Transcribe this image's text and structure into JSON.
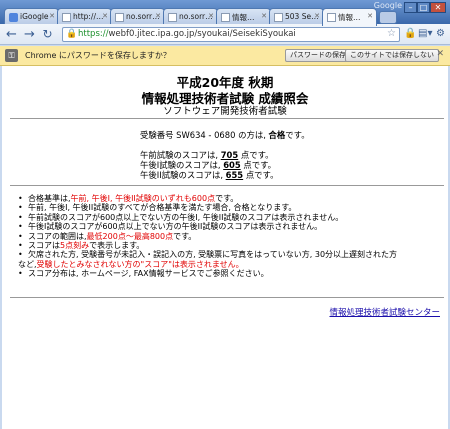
{
  "browser": {
    "google_mark": "Google",
    "tabs": [
      {
        "title": "iGoogle",
        "favicon": "google-icon"
      },
      {
        "title": "http://…",
        "favicon": "page-icon"
      },
      {
        "title": "no.sorr…",
        "favicon": "page-icon"
      },
      {
        "title": "no.sorr…",
        "favicon": "page-icon"
      },
      {
        "title": "情報…",
        "favicon": "page-icon"
      },
      {
        "title": "503 Se…",
        "favicon": "page-icon"
      },
      {
        "title": "情報…",
        "favicon": "page-icon",
        "active": true
      }
    ],
    "url_scheme": "https://",
    "url_rest": "webf0.jitec.ipa.go.jp/syoukai/SeisekiSyoukai"
  },
  "infobar": {
    "message": "Chrome にパスワードを保存しますか？",
    "save_label": "パスワードの保存",
    "never_label": "このサイトでは保存しない"
  },
  "page": {
    "title1": "平成20年度 秋期",
    "title2": "情報処理技術者試験 成績照会",
    "subtitle": "ソフトウェア開発技術者試験",
    "result_prefix": "受験番号 SW634 - 0680 の方は,",
    "result_status": "合格",
    "result_suffix": "です。",
    "scores": [
      {
        "prefix": "午前試験のスコアは,",
        "value": "705",
        "suffix": "点です。"
      },
      {
        "prefix": "午後I試験のスコアは,",
        "value": "605",
        "suffix": "点です。"
      },
      {
        "prefix": "午後II試験のスコアは,",
        "value": "655",
        "suffix": "点です。"
      }
    ],
    "notes": [
      {
        "parts": [
          {
            "t": "合格基準は,"
          },
          {
            "t": "午前, 午後I, 午後II試験のいずれも600点",
            "red": true
          },
          {
            "t": "です。"
          }
        ]
      },
      {
        "parts": [
          {
            "t": "午前, 午後I, 午後II試験のすべてが合格基準を満たす場合, 合格となります。"
          }
        ]
      },
      {
        "parts": [
          {
            "t": "午前試験のスコアが600点以上でない方の午後I, 午後II試験のスコアは表示されません。"
          }
        ]
      },
      {
        "parts": [
          {
            "t": "午後I試験のスコアが600点以上でない方の午後II試験のスコアは表示されません。"
          }
        ]
      },
      {
        "parts": [
          {
            "t": "スコアの範囲は,"
          },
          {
            "t": "最低200点～最高800点",
            "red": true
          },
          {
            "t": "です。"
          }
        ]
      },
      {
        "parts": [
          {
            "t": "スコアは"
          },
          {
            "t": "5点刻み",
            "red": true
          },
          {
            "t": "で表示します。"
          }
        ]
      },
      {
        "parts": [
          {
            "t": "欠席された方, 受験番号が未記入・誤記入の方, 受験票に写真をはっていない方, 30分以上遅刻された方"
          }
        ]
      },
      {
        "parts": [
          {
            "t": "など,"
          },
          {
            "t": "受験したとみなされない方の\"スコア\"は表示されません。",
            "red": true
          }
        ],
        "continuation": true
      },
      {
        "parts": [
          {
            "t": "スコア分布は, ホームページ, FAX情報サービスでご参照ください。"
          }
        ]
      }
    ],
    "footer_link": "情報処理技術者試験センター"
  }
}
